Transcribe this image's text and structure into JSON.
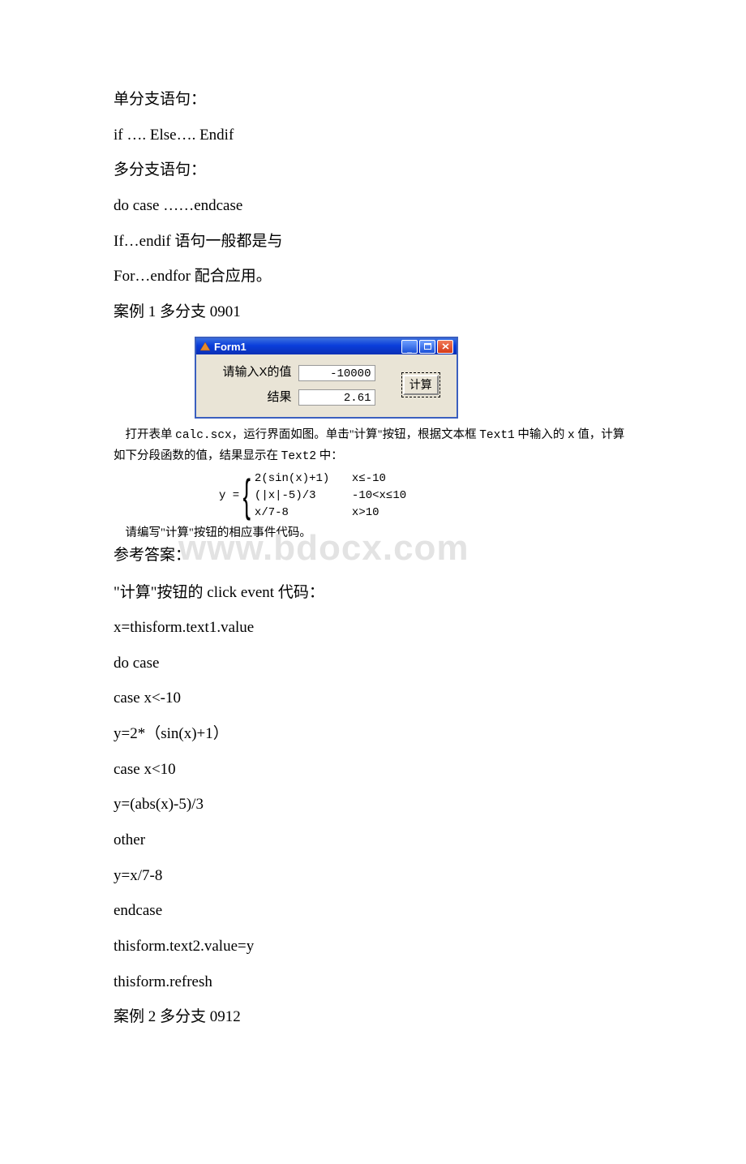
{
  "doc": {
    "p1": "单分支语句：",
    "p2": " if …. Else…. Endif",
    "p3": "多分支语句：",
    "p4": " do case ……endcase",
    "p5": "If…endif 语句一般都是与",
    "p6": "For…endfor 配合应用。",
    "p7": "案例 1 多分支 0901",
    "form": {
      "title": "Form1",
      "label1": "请输入X的值",
      "text1_value": "-10000",
      "label2": "结果",
      "text2_value": "2.61",
      "calc_button": "计算"
    },
    "desc1_pre": "打开表单 ",
    "desc1_file": "calc.scx",
    "desc1_mid": "，运行界面如图。单击\"计算\"按钮，根据文本框 ",
    "desc1_t1": "Text1",
    "desc1_mid2": " 中输入的 ",
    "desc1_x": "x",
    "desc1_mid3": " 值，计算如下分段函数的值，结果显示在 ",
    "desc1_t2": "Text2",
    "desc1_end": " 中：",
    "eq_y": "y = ",
    "eq_rows": [
      {
        "exp": "2(sin(x)+1)",
        "cond": "x≤-10"
      },
      {
        "exp": "(|x|-5)/3",
        "cond": "-10<x≤10"
      },
      {
        "exp": "x/7-8",
        "cond": "x>10"
      }
    ],
    "request": "请编写\"计算\"按钮的相应事件代码。",
    "watermark": "www.bdocx.com",
    "answer_title": "参考答案：",
    "ans1": "\"计算\"按钮的 click event 代码：",
    "code": [
      "x=thisform.text1.value",
      "do case",
      " case x<-10",
      " y=2*（sin(x)+1）",
      " case x<10",
      " y=(abs(x)-5)/3",
      " other",
      " y=x/7-8",
      "endcase",
      "thisform.text2.value=y",
      "thisform.refresh"
    ],
    "p_last": "案例 2 多分支 0912"
  }
}
